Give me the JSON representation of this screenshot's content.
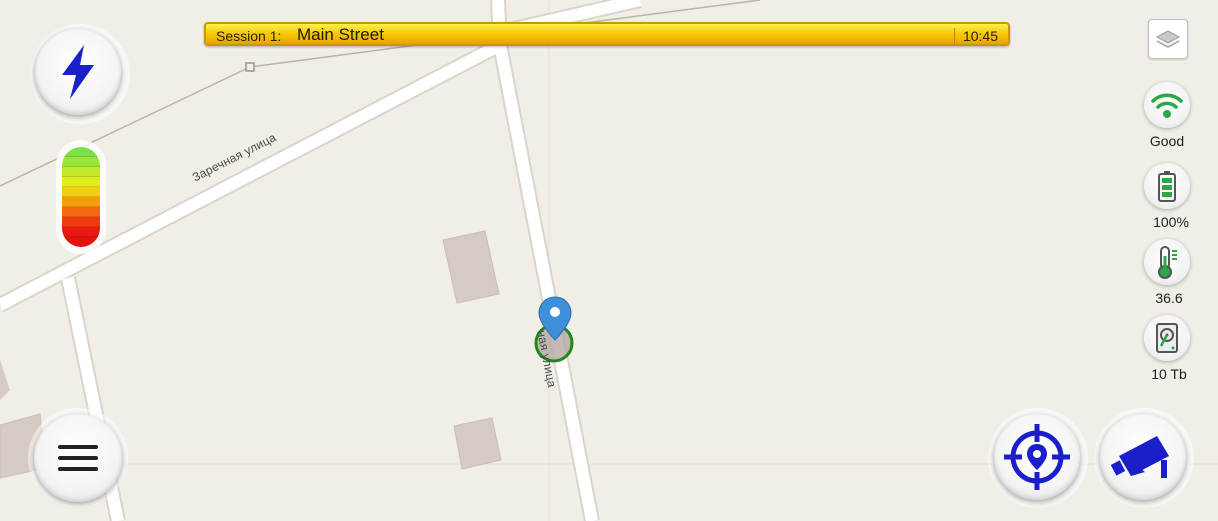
{
  "session": {
    "prefix": "Session 1:",
    "name": "Main Street",
    "time": "10:45"
  },
  "map": {
    "streets": [
      {
        "label": "Заречная улица"
      },
      {
        "label": "ная улица"
      }
    ]
  },
  "level_meter": {
    "segments": [
      "#7de04a",
      "#9be53a",
      "#c2ea2a",
      "#e3ea1c",
      "#f2cf12",
      "#f59d0c",
      "#f26b10",
      "#ee3b12",
      "#e81912",
      "#e80f10"
    ]
  },
  "controls": {
    "power_icon": "lightning-icon",
    "menu_icon": "hamburger-icon",
    "locate_icon": "crosshair-pin-icon",
    "camera_icon": "cctv-camera-icon",
    "layers_icon": "layers-icon"
  },
  "status": {
    "signal": {
      "icon": "wifi-icon",
      "label": "Good"
    },
    "battery": {
      "icon": "battery-icon",
      "label": "100%"
    },
    "temperature": {
      "icon": "thermometer-icon",
      "label": "36.6"
    },
    "storage": {
      "icon": "hard-drive-icon",
      "label": "10 Tb"
    }
  },
  "colors": {
    "accent_blue": "#1a1fc9",
    "status_green": "#2aa845",
    "session_bar": "#f5c400"
  }
}
